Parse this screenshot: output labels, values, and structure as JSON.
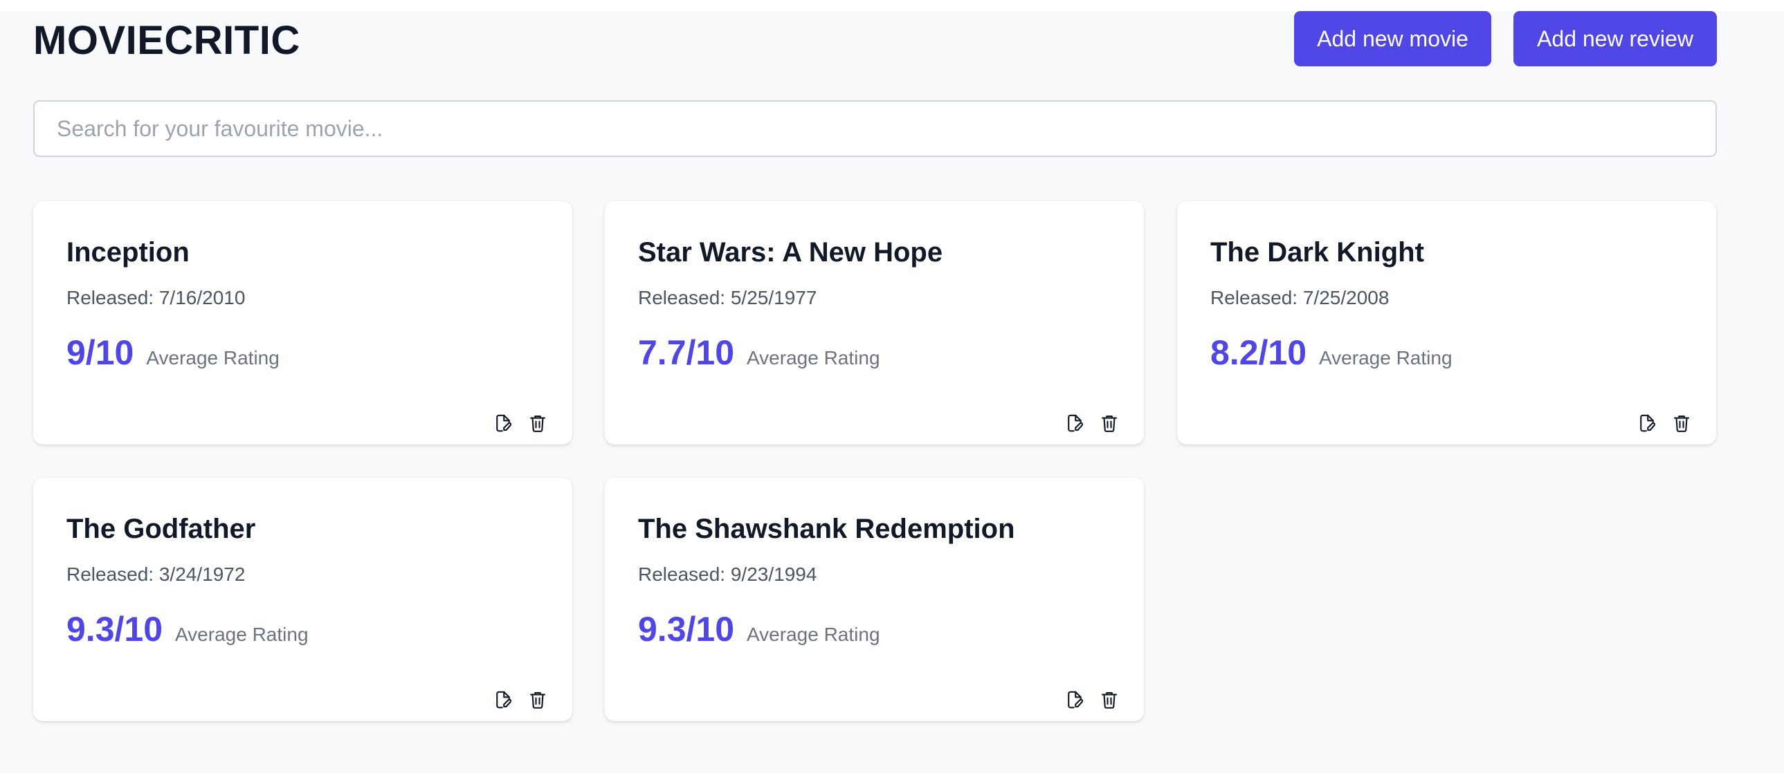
{
  "app": {
    "title": "MOVIECRITIC",
    "accent_color": "#4f46e5"
  },
  "header": {
    "add_movie_label": "Add new movie",
    "add_review_label": "Add new review"
  },
  "search": {
    "placeholder": "Search for your favourite movie...",
    "value": ""
  },
  "movies": [
    {
      "title": "Inception",
      "released": "Released: 7/16/2010",
      "rating": "9/10",
      "rating_label": "Average Rating"
    },
    {
      "title": "Star Wars: A New Hope",
      "released": "Released: 5/25/1977",
      "rating": "7.7/10",
      "rating_label": "Average Rating"
    },
    {
      "title": "The Dark Knight",
      "released": "Released: 7/25/2008",
      "rating": "8.2/10",
      "rating_label": "Average Rating"
    },
    {
      "title": "The Godfather",
      "released": "Released: 3/24/1972",
      "rating": "9.3/10",
      "rating_label": "Average Rating"
    },
    {
      "title": "The Shawshank Redemption",
      "released": "Released: 9/23/1994",
      "rating": "9.3/10",
      "rating_label": "Average Rating"
    }
  ],
  "icons": {
    "edit": "edit-icon",
    "delete": "trash-icon"
  }
}
